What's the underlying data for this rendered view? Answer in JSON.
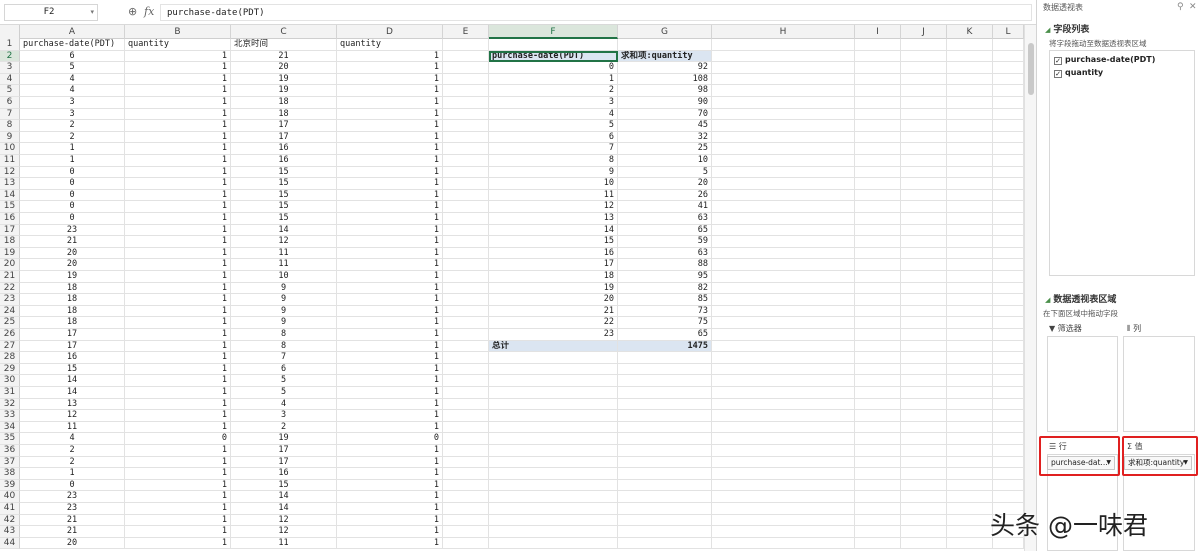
{
  "formula_bar": {
    "name_box": "F2",
    "zoom_icon": "zoom-icon",
    "fx_label": "fx",
    "formula": "purchase-date(PDT)"
  },
  "columns": [
    "A",
    "B",
    "C",
    "D",
    "E",
    "F",
    "G",
    "H",
    "I",
    "J",
    "K",
    "L"
  ],
  "active_column": "F",
  "active_row": "2",
  "header_row": [
    "purchase-date(PDT)",
    "quantity",
    "北京时间",
    "quantity"
  ],
  "data_rows": [
    [
      6,
      1,
      21,
      1
    ],
    [
      5,
      1,
      20,
      1
    ],
    [
      4,
      1,
      19,
      1
    ],
    [
      4,
      1,
      19,
      1
    ],
    [
      3,
      1,
      18,
      1
    ],
    [
      3,
      1,
      18,
      1
    ],
    [
      2,
      1,
      17,
      1
    ],
    [
      2,
      1,
      17,
      1
    ],
    [
      1,
      1,
      16,
      1
    ],
    [
      1,
      1,
      16,
      1
    ],
    [
      0,
      1,
      15,
      1
    ],
    [
      0,
      1,
      15,
      1
    ],
    [
      0,
      1,
      15,
      1
    ],
    [
      0,
      1,
      15,
      1
    ],
    [
      0,
      1,
      15,
      1
    ],
    [
      23,
      1,
      14,
      1
    ],
    [
      21,
      1,
      12,
      1
    ],
    [
      20,
      1,
      11,
      1
    ],
    [
      20,
      1,
      11,
      1
    ],
    [
      19,
      1,
      10,
      1
    ],
    [
      18,
      1,
      9,
      1
    ],
    [
      18,
      1,
      9,
      1
    ],
    [
      18,
      1,
      9,
      1
    ],
    [
      18,
      1,
      9,
      1
    ],
    [
      17,
      1,
      8,
      1
    ],
    [
      17,
      1,
      8,
      1
    ],
    [
      16,
      1,
      7,
      1
    ],
    [
      15,
      1,
      6,
      1
    ],
    [
      14,
      1,
      5,
      1
    ],
    [
      14,
      1,
      5,
      1
    ],
    [
      13,
      1,
      4,
      1
    ],
    [
      12,
      1,
      3,
      1
    ],
    [
      11,
      1,
      2,
      1
    ],
    [
      4,
      0,
      19,
      0
    ],
    [
      2,
      1,
      17,
      1
    ],
    [
      2,
      1,
      17,
      1
    ],
    [
      1,
      1,
      16,
      1
    ],
    [
      0,
      1,
      15,
      1
    ],
    [
      23,
      1,
      14,
      1
    ],
    [
      23,
      1,
      14,
      1
    ],
    [
      21,
      1,
      12,
      1
    ],
    [
      21,
      1,
      12,
      1
    ],
    [
      20,
      1,
      11,
      1
    ]
  ],
  "pivot": {
    "row_header": "purchase-date(PDT)",
    "value_header": "求和项:quantity",
    "rows": [
      [
        0,
        92
      ],
      [
        1,
        108
      ],
      [
        2,
        98
      ],
      [
        3,
        90
      ],
      [
        4,
        70
      ],
      [
        5,
        45
      ],
      [
        6,
        32
      ],
      [
        7,
        25
      ],
      [
        8,
        10
      ],
      [
        9,
        5
      ],
      [
        10,
        20
      ],
      [
        11,
        26
      ],
      [
        12,
        41
      ],
      [
        13,
        63
      ],
      [
        14,
        65
      ],
      [
        15,
        59
      ],
      [
        16,
        63
      ],
      [
        17,
        88
      ],
      [
        18,
        95
      ],
      [
        19,
        82
      ],
      [
        20,
        85
      ],
      [
        21,
        73
      ],
      [
        22,
        75
      ],
      [
        23,
        65
      ]
    ],
    "total_label": "总计",
    "total_value": 1475
  },
  "panel": {
    "title": "数据透视表",
    "field_list_title": "字段列表",
    "field_list_sub": "将字段拖动至数据透视表区域",
    "fields": [
      {
        "label": "purchase-date(PDT)",
        "checked": true
      },
      {
        "label": "quantity",
        "checked": true
      }
    ],
    "areas_title": "数据透视表区域",
    "areas_sub": "在下面区域中拖动字段",
    "filter_label": "筛选器",
    "column_label": "列",
    "row_label": "行",
    "value_label": "值",
    "row_chip": "purchase-dat...",
    "value_chip": "求和项:quantity",
    "highlight_color": "#e02020"
  },
  "watermark": "头条 @一味君"
}
